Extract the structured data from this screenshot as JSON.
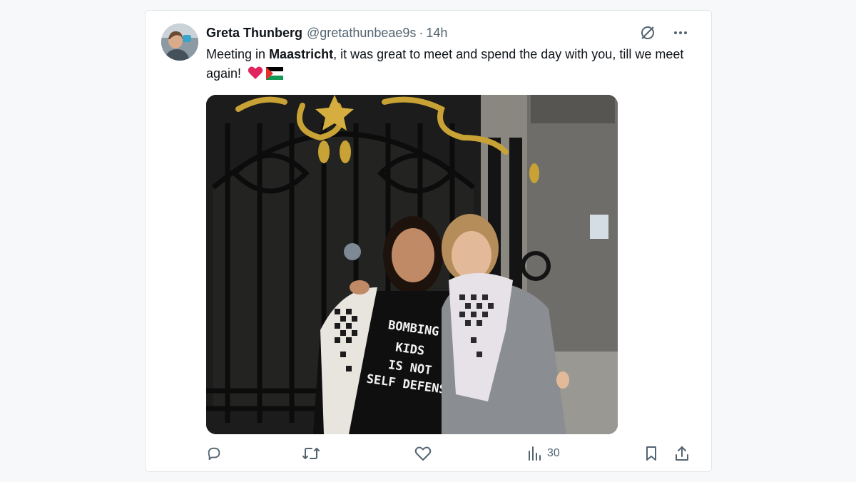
{
  "tweet": {
    "author_name": "Greta Thunberg",
    "author_handle": "@gretathunbeae9s",
    "separator": "·",
    "time": "14h",
    "text_part1": "Meeting in ",
    "text_bold": "Maastricht",
    "text_part2": ", it was great to meet and spend the day with you, till we meet again!",
    "emojis": [
      "red-heart",
      "palestine-flag"
    ],
    "photo_shirt_text": [
      "BOMBING",
      "KIDS",
      "IS NOT",
      "SELF DEFENSE"
    ]
  },
  "actions": {
    "views_count": "30"
  },
  "icons": {
    "avatar": "avatar",
    "grok": "grok-icon",
    "more": "more-icon",
    "reply": "reply-icon",
    "retweet": "retweet-icon",
    "like": "like-icon",
    "views": "views-icon",
    "bookmark": "bookmark-icon",
    "share": "share-icon"
  },
  "colors": {
    "text": "#0f1419",
    "secondary": "#536471",
    "border": "#e3e6e8",
    "heart": "#e0245e"
  }
}
